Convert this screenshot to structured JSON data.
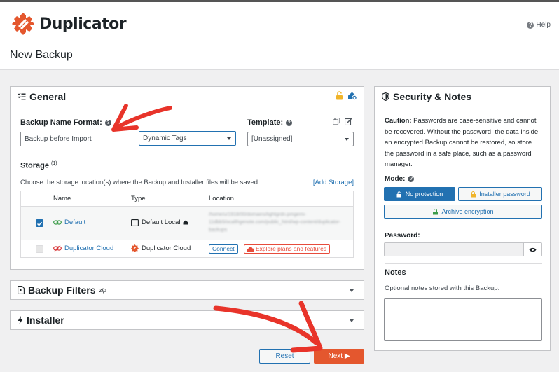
{
  "app": {
    "name": "Duplicator",
    "help_label": "Help"
  },
  "page": {
    "title": "New Backup"
  },
  "general": {
    "title": "General",
    "backup_name_format_label": "Backup Name Format:",
    "backup_name_value": "Backup before Import",
    "name_tags_selected": "Dynamic Tags",
    "template_label": "Template:",
    "template_selected": "[Unassigned]",
    "storage_title": "Storage",
    "storage_sup": "(1)",
    "storage_desc": "Choose the storage location(s) where the Backup and Installer files will be saved.",
    "add_storage": "[Add Storage]",
    "columns": [
      "Name",
      "Type",
      "Location"
    ],
    "rows": [
      {
        "checked": true,
        "name": "Default",
        "type": "Default Local",
        "location": "/home/u/1918/00/domains/lightgrdn.pmgemi-11dbb5/ocalthgenote.com/public_html/wp-content/duplicator-backups"
      },
      {
        "checked": false,
        "name": "Duplicator Cloud",
        "type": "Duplicator Cloud",
        "connect_label": "Connect",
        "explore_label": "Explore plans and features"
      }
    ]
  },
  "backup_filters": {
    "title": "Backup Filters",
    "sup": "zip"
  },
  "installer": {
    "title": "Installer"
  },
  "actions": {
    "reset": "Reset",
    "next": "Next ▶"
  },
  "security": {
    "title": "Security & Notes",
    "caution_bold": "Caution:",
    "caution_text": " Passwords are case-sensitive and cannot be recovered. Without the password, the data inside an encrypted Backup cannot be restored, so store the password in a safe place, such as a password manager.",
    "mode_label": "Mode:",
    "modes": [
      "No protection",
      "Installer password",
      "Archive encryption"
    ],
    "password_label": "Password:",
    "notes_label": "Notes",
    "notes_desc": "Optional notes stored with this Backup."
  },
  "colors": {
    "accent": "#2271b1",
    "brand": "#e4572e",
    "annotation": "#e8342a"
  }
}
